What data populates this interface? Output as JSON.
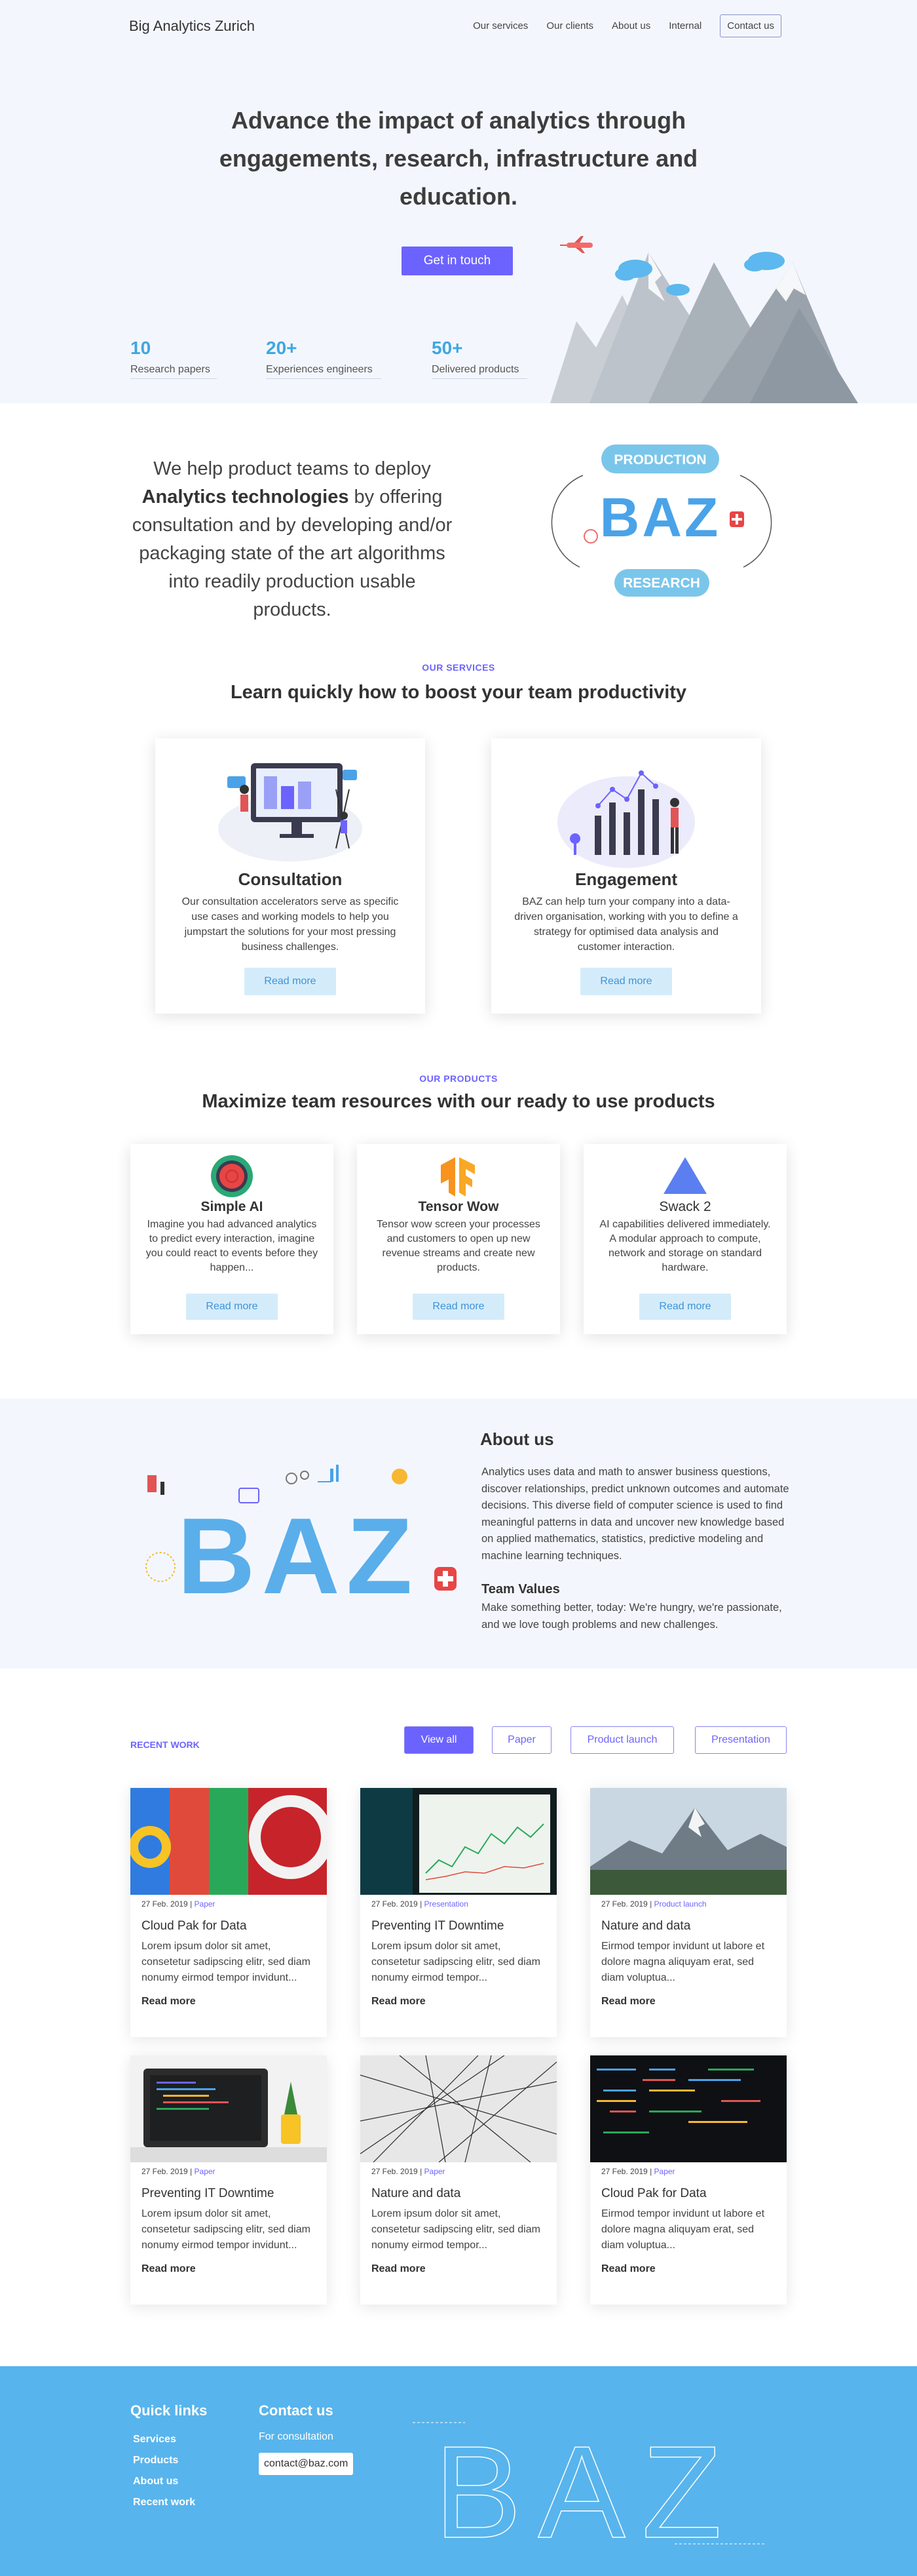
{
  "header": {
    "brand": "Big Analytics Zurich",
    "nav": [
      "Our services",
      "Our clients",
      "About us",
      "Internal"
    ],
    "contact": "Contact us"
  },
  "hero": {
    "title": "Advance the impact of analytics through engagements, research, infrastructure and education.",
    "button": "Get in touch",
    "stats": [
      {
        "num": "10",
        "label": "Research papers"
      },
      {
        "num": "20+",
        "label": "Experiences engineers"
      },
      {
        "num": "50+",
        "label": "Delivered products"
      }
    ]
  },
  "intro": {
    "pre": "We help product teams to deploy ",
    "bold": "Analytics technologies",
    "post": " by offering consultation and by developing and/or packaging state of the art algorithms into readily production usable products.",
    "logo": {
      "top": "PRODUCTION",
      "mid": "BAZ",
      "bottom": "RESEARCH"
    }
  },
  "services": {
    "tag": "OUR SERVICES",
    "title": "Learn quickly how to boost your team productivity",
    "cards": [
      {
        "title": "Consultation",
        "desc": "Our consultation accelerators serve as specific use cases and working models to help you jumpstart the solutions for your most pressing business challenges.",
        "button": "Read more",
        "icon": "presentation-illustration"
      },
      {
        "title": "Engagement",
        "desc": "BAZ can help turn your company into a data-driven organisation, working with you to define a strategy for optimised data analysis and customer interaction.",
        "button": "Read more",
        "icon": "chart-illustration"
      }
    ]
  },
  "products": {
    "tag": "OUR PRODUCTS",
    "title": "Maximize team resources with our ready to use products",
    "cards": [
      {
        "title": "Simple AI",
        "desc": "Imagine you had advanced analytics to predict every interaction, imagine you could react to events before they happen...",
        "button": "Read more",
        "icon": "target-icon"
      },
      {
        "title": "Tensor Wow",
        "desc": "Tensor wow screen your processes and customers to open up new revenue streams and create new products.",
        "button": "Read more",
        "icon": "tensorflow-icon"
      },
      {
        "title": "Swack 2",
        "desc": "AI capabilities delivered immediately. A modular approach to compute, network and storage on standard hardware.",
        "button": "Read more",
        "icon": "triangle-icon"
      }
    ]
  },
  "about": {
    "title": "About us",
    "body": "Analytics uses data and math to answer business questions, discover relationships, predict unknown outcomes and automate decisions. This diverse field of computer science is used to find meaningful patterns in data and uncover new knowledge based on applied mathematics, statistics, predictive modeling and machine learning techniques.",
    "values_title": "Team Values",
    "values_body": "Make something better, today: We're hungry, we're passionate, and we love tough problems and new challenges.",
    "art_text": "BAZ"
  },
  "recent": {
    "label": "RECENT WORK",
    "filters": [
      "View all",
      "Paper",
      "Product launch",
      "Presentation"
    ],
    "posts": [
      {
        "date": "27 Feb. 2019",
        "category": "Paper",
        "title": "Cloud Pak for Data",
        "desc": "Lorem ipsum dolor sit amet, consetetur sadipscing elitr, sed diam nonumy eirmod tempor invidunt...",
        "more": "Read more",
        "image": "google-sign-photo"
      },
      {
        "date": "27 Feb. 2019",
        "category": "Presentation",
        "title": "Preventing IT Downtime",
        "desc": "Lorem ipsum dolor sit amet, consetetur sadipscing elitr, sed diam nonumy eirmod tempor...",
        "more": "Read more",
        "image": "stock-chart-photo"
      },
      {
        "date": "27 Feb. 2019",
        "category": "Product launch",
        "title": "Nature and data",
        "desc": "Eirmod tempor invidunt ut labore et dolore magna aliquyam erat, sed diam voluptua...",
        "more": "Read more",
        "image": "mountain-photo"
      },
      {
        "date": "27 Feb. 2019",
        "category": "Paper",
        "title": "Preventing IT Downtime",
        "desc": "Lorem ipsum dolor sit amet, consetetur sadipscing elitr, sed diam nonumy eirmod tempor invidunt...",
        "more": "Read more",
        "image": "laptop-code-photo"
      },
      {
        "date": "27 Feb. 2019",
        "category": "Paper",
        "title": "Nature and data",
        "desc": "Lorem ipsum dolor sit amet, consetetur sadipscing elitr, sed diam nonumy eirmod tempor...",
        "more": "Read more",
        "image": "network-lines-photo"
      },
      {
        "date": "27 Feb. 2019",
        "category": "Paper",
        "title": "Cloud Pak for Data",
        "desc": "Eirmod tempor invidunt ut labore et dolore magna aliquyam erat, sed diam voluptua...",
        "more": "Read more",
        "image": "code-screen-photo"
      }
    ]
  },
  "footer": {
    "quick_title": "Quick links",
    "links": [
      "Services",
      "Products",
      "About us",
      "Recent work"
    ],
    "contact_title": "Contact us",
    "consult": "For consultation",
    "email": "contact@baz.com",
    "art_text": "BAZ"
  },
  "colors": {
    "accent": "#6c63ff",
    "blue": "#3fa7e0",
    "footer": "#58b4ec",
    "hero_bg": "#f3f7fd"
  }
}
